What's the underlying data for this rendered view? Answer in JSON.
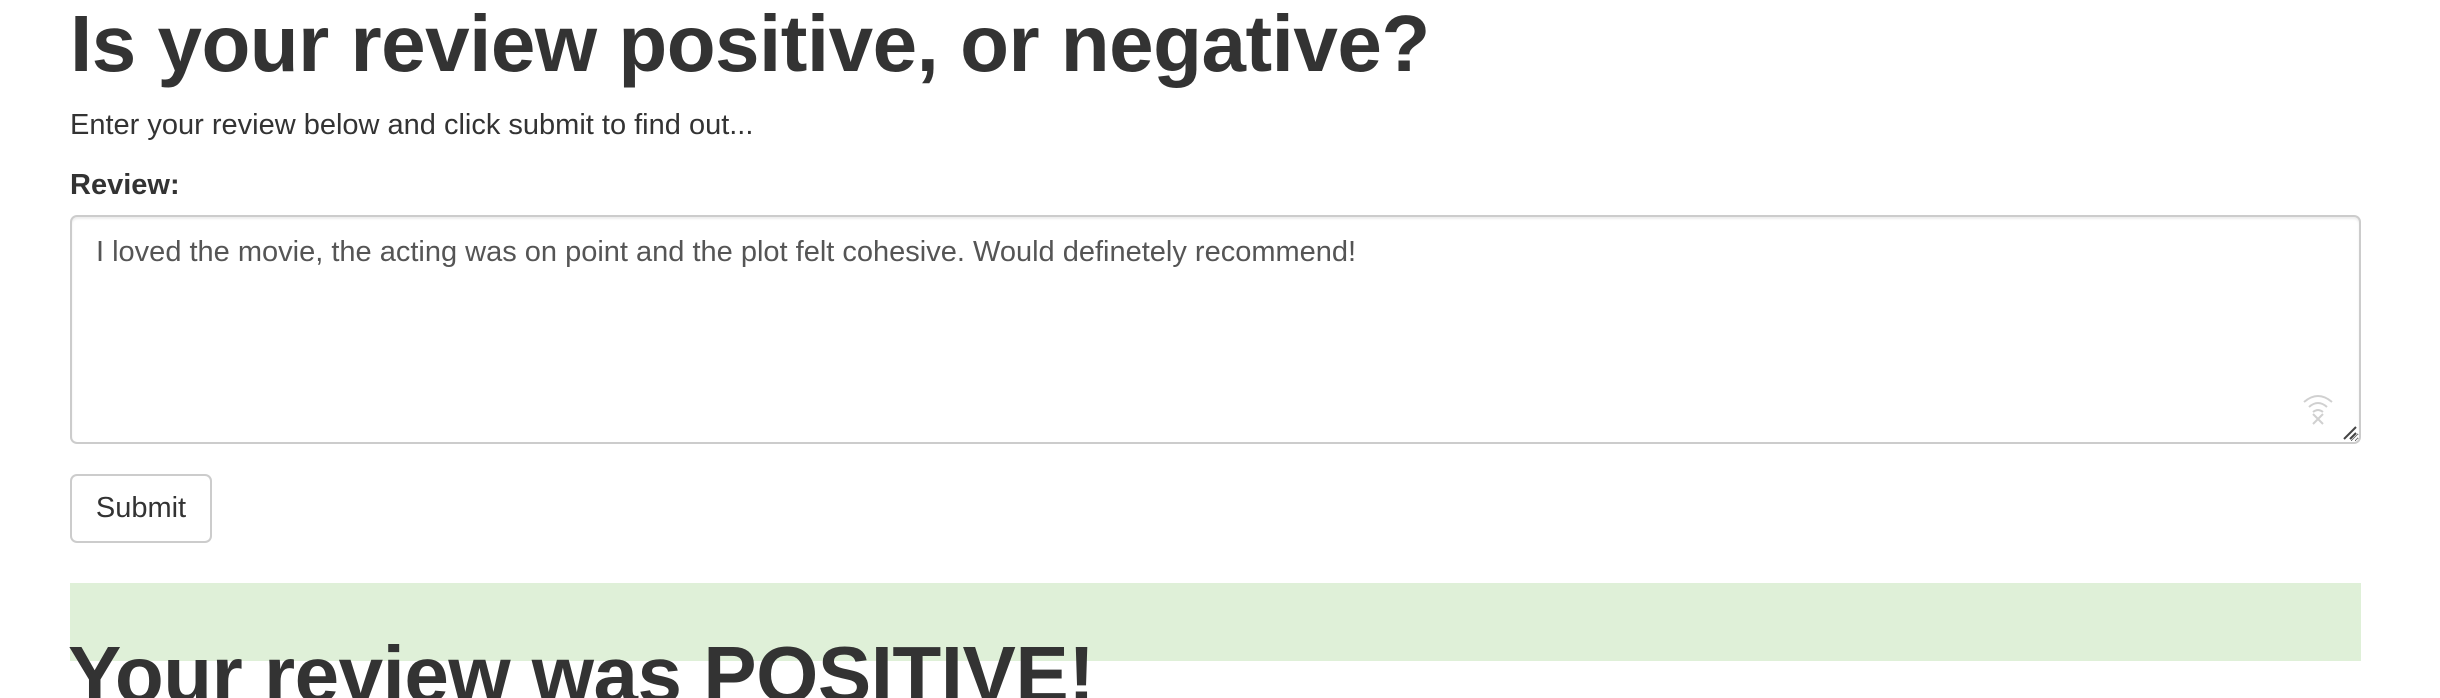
{
  "header": {
    "title": "Is your review positive, or negative?",
    "subtitle": "Enter your review below and click submit to find out..."
  },
  "form": {
    "review_label": "Review:",
    "review_value": "I loved the movie, the acting was on point and the plot felt cohesive. Would definetely recommend!",
    "submit_label": "Submit"
  },
  "result": {
    "text": "Your review was POSITIVE!",
    "background_color": "#dff0d8"
  },
  "icons": {
    "textarea_icon": "wifi-off-icon",
    "resize": "resize-grip-icon"
  }
}
